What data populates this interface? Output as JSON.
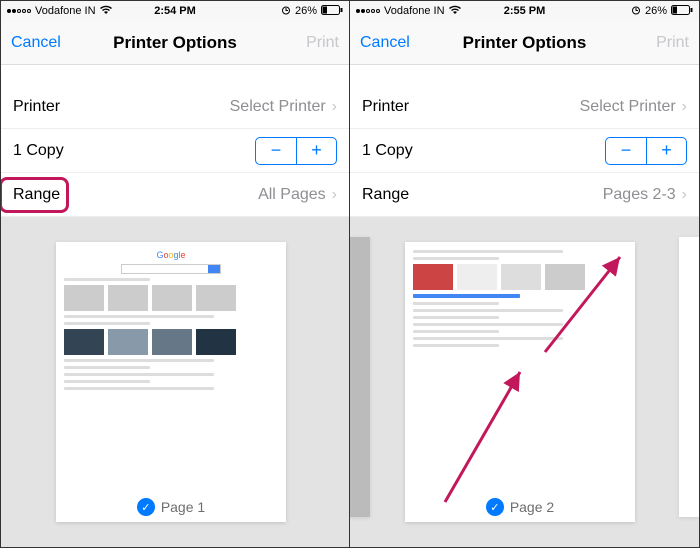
{
  "left": {
    "statusbar": {
      "carrier": "Vodafone IN",
      "time": "2:54 PM",
      "battery": "26%"
    },
    "nav": {
      "cancel": "Cancel",
      "title": "Printer Options",
      "print": "Print"
    },
    "rows": {
      "printer_label": "Printer",
      "printer_value": "Select Printer",
      "copies_label": "1 Copy",
      "range_label": "Range",
      "range_value": "All Pages"
    },
    "page_caption": "Page 1"
  },
  "right": {
    "statusbar": {
      "carrier": "Vodafone IN",
      "time": "2:55 PM",
      "battery": "26%"
    },
    "nav": {
      "cancel": "Cancel",
      "title": "Printer Options",
      "print": "Print"
    },
    "rows": {
      "printer_label": "Printer",
      "printer_value": "Select Printer",
      "copies_label": "1 Copy",
      "range_label": "Range",
      "range_value": "Pages 2-3"
    },
    "page_caption": "Page 2"
  }
}
